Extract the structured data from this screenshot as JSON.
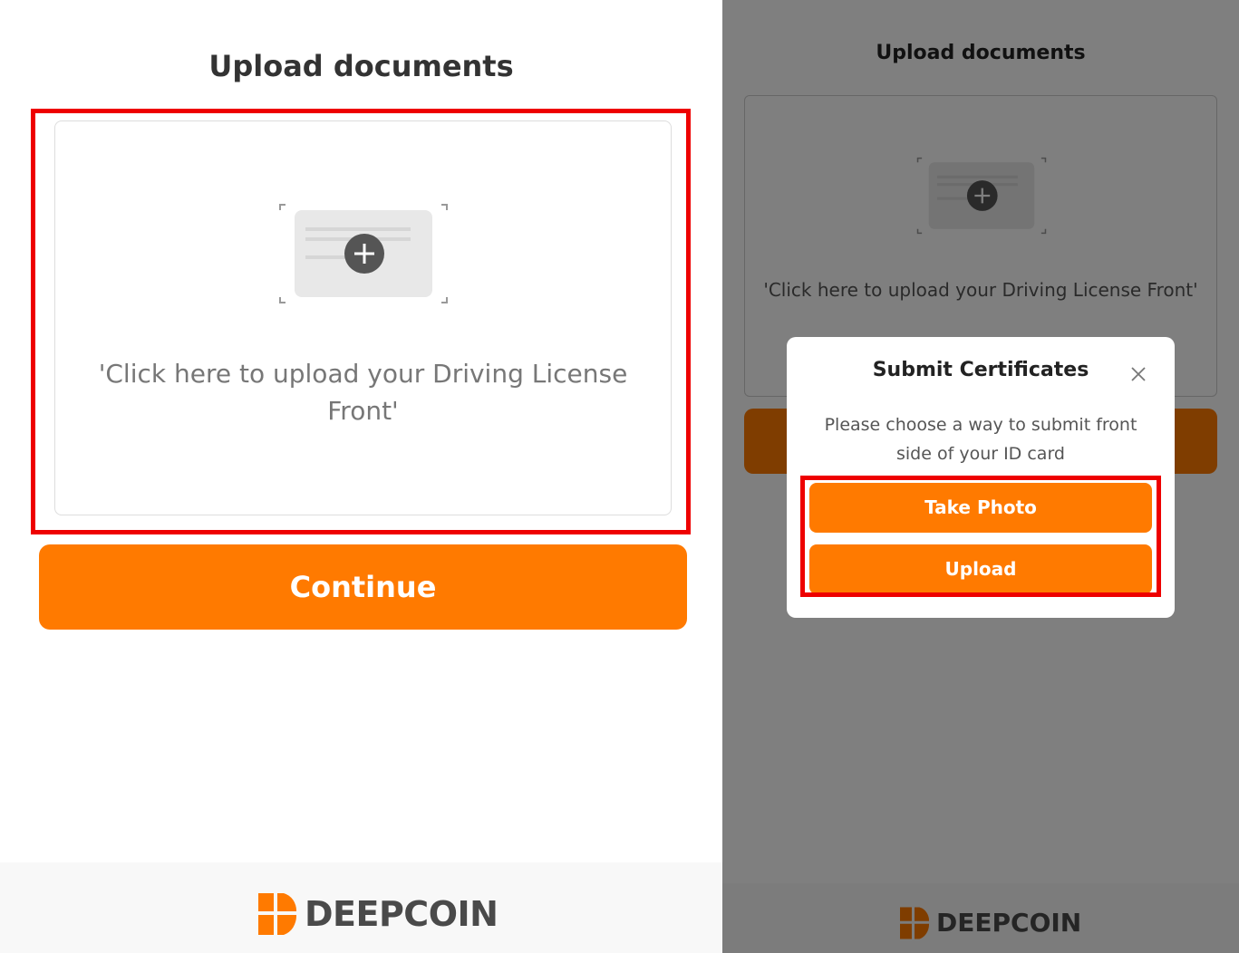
{
  "left": {
    "title": "Upload documents",
    "upload_card_text": "'Click here to upload your Driving License Front'",
    "continue_label": "Continue",
    "brand": "DEEPCOIN"
  },
  "right": {
    "title": "Upload documents",
    "upload_card_text": "'Click here to upload your Driving License Front'",
    "brand": "DEEPCOIN",
    "modal": {
      "title": "Submit Certificates",
      "description": "Please choose a way to submit front side of your ID card",
      "take_photo_label": "Take Photo",
      "upload_label": "Upload"
    }
  },
  "colors": {
    "accent": "#ff7a00",
    "highlight": "#ee0000",
    "overlay": "rgba(0,0,0,0.5)"
  },
  "icons": [
    "id-card-plus-icon",
    "close-icon",
    "deepcoin-logo-icon"
  ]
}
